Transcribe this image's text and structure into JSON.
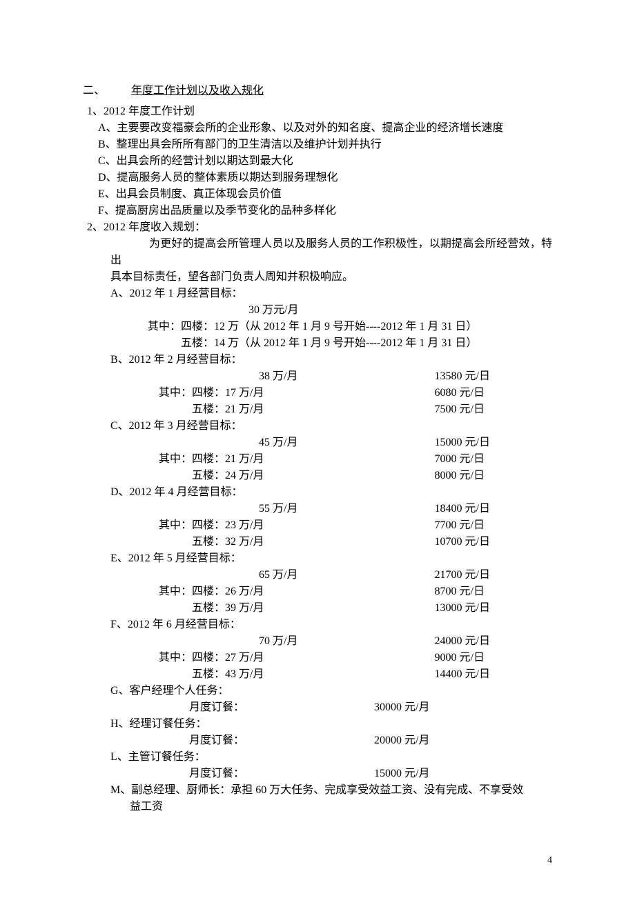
{
  "heading": {
    "num": "二、",
    "title": "年度工作计划以及收入规化"
  },
  "sec1": {
    "header": "1、2012 年度工作计划",
    "items": {
      "a": "A、主要要改变福豪会所的企业形象、以及对外的知名度、提高企业的经济增长速度",
      "b": "B、整理出具会所所有部门的卫生清洁以及维护计划并执行",
      "c": "C、出具会所的经营计划以期达到最大化",
      "d": "D、提高服务人员的整体素质以期达到服务理想化",
      "e": "E、出具会员制度、真正体现会员价值",
      "f": "F、提高厨房出品质量以及季节变化的品种多样化"
    }
  },
  "sec2": {
    "header": "2、2012 年度收入规划：",
    "intro_l1": "为更好的提高会所管理人员以及服务人员的工作积极性，以期提高会所经营效，特出",
    "intro_l2": "具本目标责任，望各部门负责人周知并积极响应。",
    "jan": {
      "label": "A、2012 年 1 月经营目标：",
      "total": "30 万元/月",
      "f4": "其中：四楼：12 万（从 2012 年 1 月 9 号开始----2012 年 1 月 31 日）",
      "f5": "五楼：14 万（从 2012 年 1 月 9 号开始----2012 年 1 月 31 日）"
    },
    "months": {
      "b": {
        "label": "B、2012 年 2 月经营目标：",
        "total_m": "38 万/月",
        "total_d": "13580 元/日",
        "f4_m": "其中：四楼：17 万/月",
        "f4_d": "6080 元/日",
        "f5_m": "五楼：21 万/月",
        "f5_d": "7500 元/日"
      },
      "c": {
        "label": "C、2012 年 3 月经营目标：",
        "total_m": "45 万/月",
        "total_d": "15000 元/日",
        "f4_m": "其中：四楼：21 万/月",
        "f4_d": "7000 元/日",
        "f5_m": "五楼：24 万/月",
        "f5_d": "8000 元/日"
      },
      "d": {
        "label": "D、2012 年 4 月经营目标：",
        "total_m": "55 万/月",
        "total_d": "18400 元/日",
        "f4_m": "其中：四楼：23 万/月",
        "f4_d": "7700 元/日",
        "f5_m": "五楼：32 万/月",
        "f5_d": "10700 元/日"
      },
      "e": {
        "label": "E、2012 年 5 月经营目标：",
        "total_m": "65 万/月",
        "total_d": "21700 元/日",
        "f4_m": "其中：四楼：26 万/月",
        "f4_d": "8700 元/日",
        "f5_m": "五楼：39 万/月",
        "f5_d": "13000 元/日"
      },
      "f": {
        "label": "F、2012 年 6 月经营目标：",
        "total_m": "70 万/月",
        "total_d": "24000 元/日",
        "f4_m": "其中：四楼：27 万/月",
        "f4_d": "9000 元/日",
        "f5_m": "五楼：43 万/月",
        "f5_d": "14400 元/日"
      }
    },
    "tasks": {
      "g": {
        "label": "G、客户经理个人任务：",
        "item_l": "月度订餐：",
        "item_v": "30000 元/月"
      },
      "h": {
        "label": "H、经理订餐任务：",
        "item_l": "月度订餐：",
        "item_v": "20000 元/月"
      },
      "l": {
        "label": "L、主管订餐任务：",
        "item_l": "月度订餐：",
        "item_v": "15000 元/月"
      }
    },
    "m": {
      "l1": "M、副总经理、厨师长：承担 60 万大任务、完成享受效益工资、没有完成、不享受效",
      "l2": "益工资"
    }
  },
  "page_number": "4"
}
